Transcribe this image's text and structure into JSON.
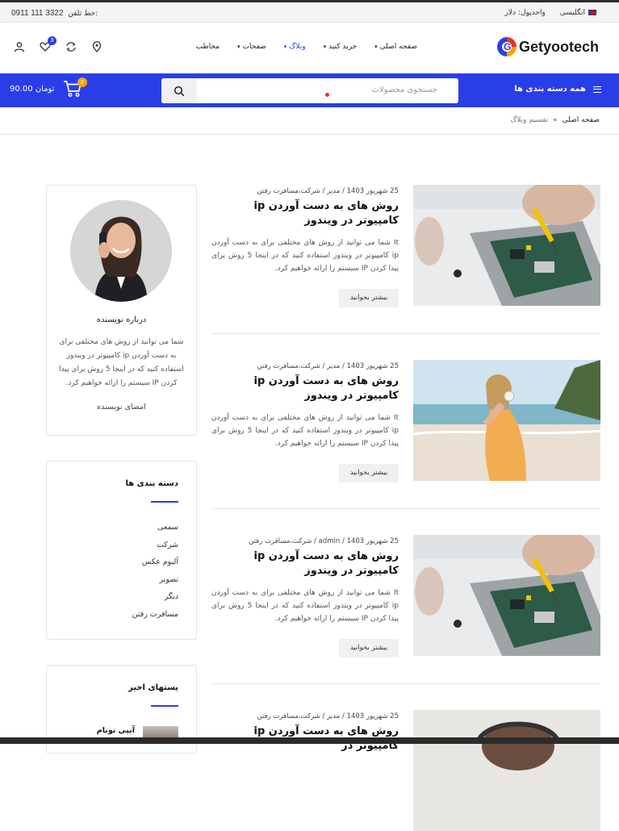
{
  "topbar": {
    "phone_label": "خط تلفن:",
    "phone_number": "0911 111 3322",
    "language": "انگلیسی",
    "currency_label": "واحدپول:",
    "currency_value": "دلار"
  },
  "header": {
    "logo_text": "Getyootech",
    "nav": [
      {
        "label": "صفحه اصلی",
        "has_dropdown": true,
        "active": false
      },
      {
        "label": "خرید کنید",
        "has_dropdown": true,
        "active": false
      },
      {
        "label": "وبلاگ",
        "has_dropdown": true,
        "active": true
      },
      {
        "label": "صفحات",
        "has_dropdown": true,
        "active": false
      },
      {
        "label": "مخاطب",
        "has_dropdown": false,
        "active": false
      }
    ],
    "icons": {
      "location": "location-pin-icon",
      "compare": "refresh-icon",
      "wishlist": "heart-icon",
      "account": "user-icon"
    },
    "wishlist_count": "3"
  },
  "bluebar": {
    "all_categories": "همه دسته بندی ها",
    "search_placeholder": "جستجوی محصولات",
    "cart_total": "90.00 تومان",
    "cart_count": "3"
  },
  "breadcrumb": {
    "home": "صفحه اصلی",
    "separator": "»",
    "current": "تقسیم وبلاگ"
  },
  "posts": [
    {
      "date": "25 شهریور 1403",
      "author": "مدیر",
      "category": "شرکت،مسافرت رفتن",
      "title": "روش های به دست آوردن ip کامپیوتر در ویندوز",
      "excerpt": "It شما می توانید از روش های مختلفی برای به دست آوردن ip کامپیوتر در ویندوز استفاده کنید که در اینجا 5 روش برای پیدا کردن IP سیستم را ارائه خواهیم کرد.",
      "read_more": "بیشتر بخوانید",
      "image": "laptop-repair"
    },
    {
      "date": "25 شهریور 1403",
      "author": "مدیر",
      "category": "شرکت،مسافرت رفتن",
      "title": "روش های به دست آوردن ip کامپیوتر در ویندوز",
      "excerpt": "It شما می توانید از روش های مختلفی برای به دست آوردن ip کامپیوتر در ویندوز استفاده کنید که در اینجا 5 روش برای پیدا کردن IP سیستم را ارائه خواهیم کرد.",
      "read_more": "بیشتر بخوانید",
      "image": "beach-headphones"
    },
    {
      "date": "25 شهریور 1403",
      "author": "admin",
      "category": "شرکت،مسافرت رفتن",
      "title": "روش های به دست آوردن ip کامپیوتر در ویندوز",
      "excerpt": "It شما می توانید از روش های مختلفی برای به دست آوردن ip کامپیوتر در ویندوز استفاده کنید که در اینجا 5 روش برای پیدا کردن IP سیستم را ارائه خواهیم کرد.",
      "read_more": "بیشتر بخوانید",
      "image": "laptop-repair"
    },
    {
      "date": "25 شهریور 1403",
      "author": "مدیر",
      "category": "شرکت،مسافرت رفتن",
      "title": "روش های به دست آوردن ip کامپیوتر در",
      "excerpt": "",
      "read_more": "",
      "image": "headphones-man"
    }
  ],
  "sidebar": {
    "author": {
      "title": "درباره نویسنده",
      "description": "شما می توانید از روش های مختلفی برای به دست آوردن ip کامپیوتر در ویندوز استفاده کنید که در اینجا 5 روش برای پیدا کردن IP سیستم را ارائه خواهیم کرد.",
      "signature": "امضای نویسنده"
    },
    "categories": {
      "title": "دسته بندی ها",
      "items": [
        "سمعی",
        "شرکت",
        "آلبوم عکس",
        "تصویر",
        "دیگر",
        "مسافرت رفتن"
      ]
    },
    "recent": {
      "title": "پستهای اخیر",
      "first_item": "آیپی نونام"
    }
  },
  "colors": {
    "accent": "#2a3ee8",
    "badge_orange": "#f7a600",
    "topbar_bg": "#f4f4f4"
  }
}
